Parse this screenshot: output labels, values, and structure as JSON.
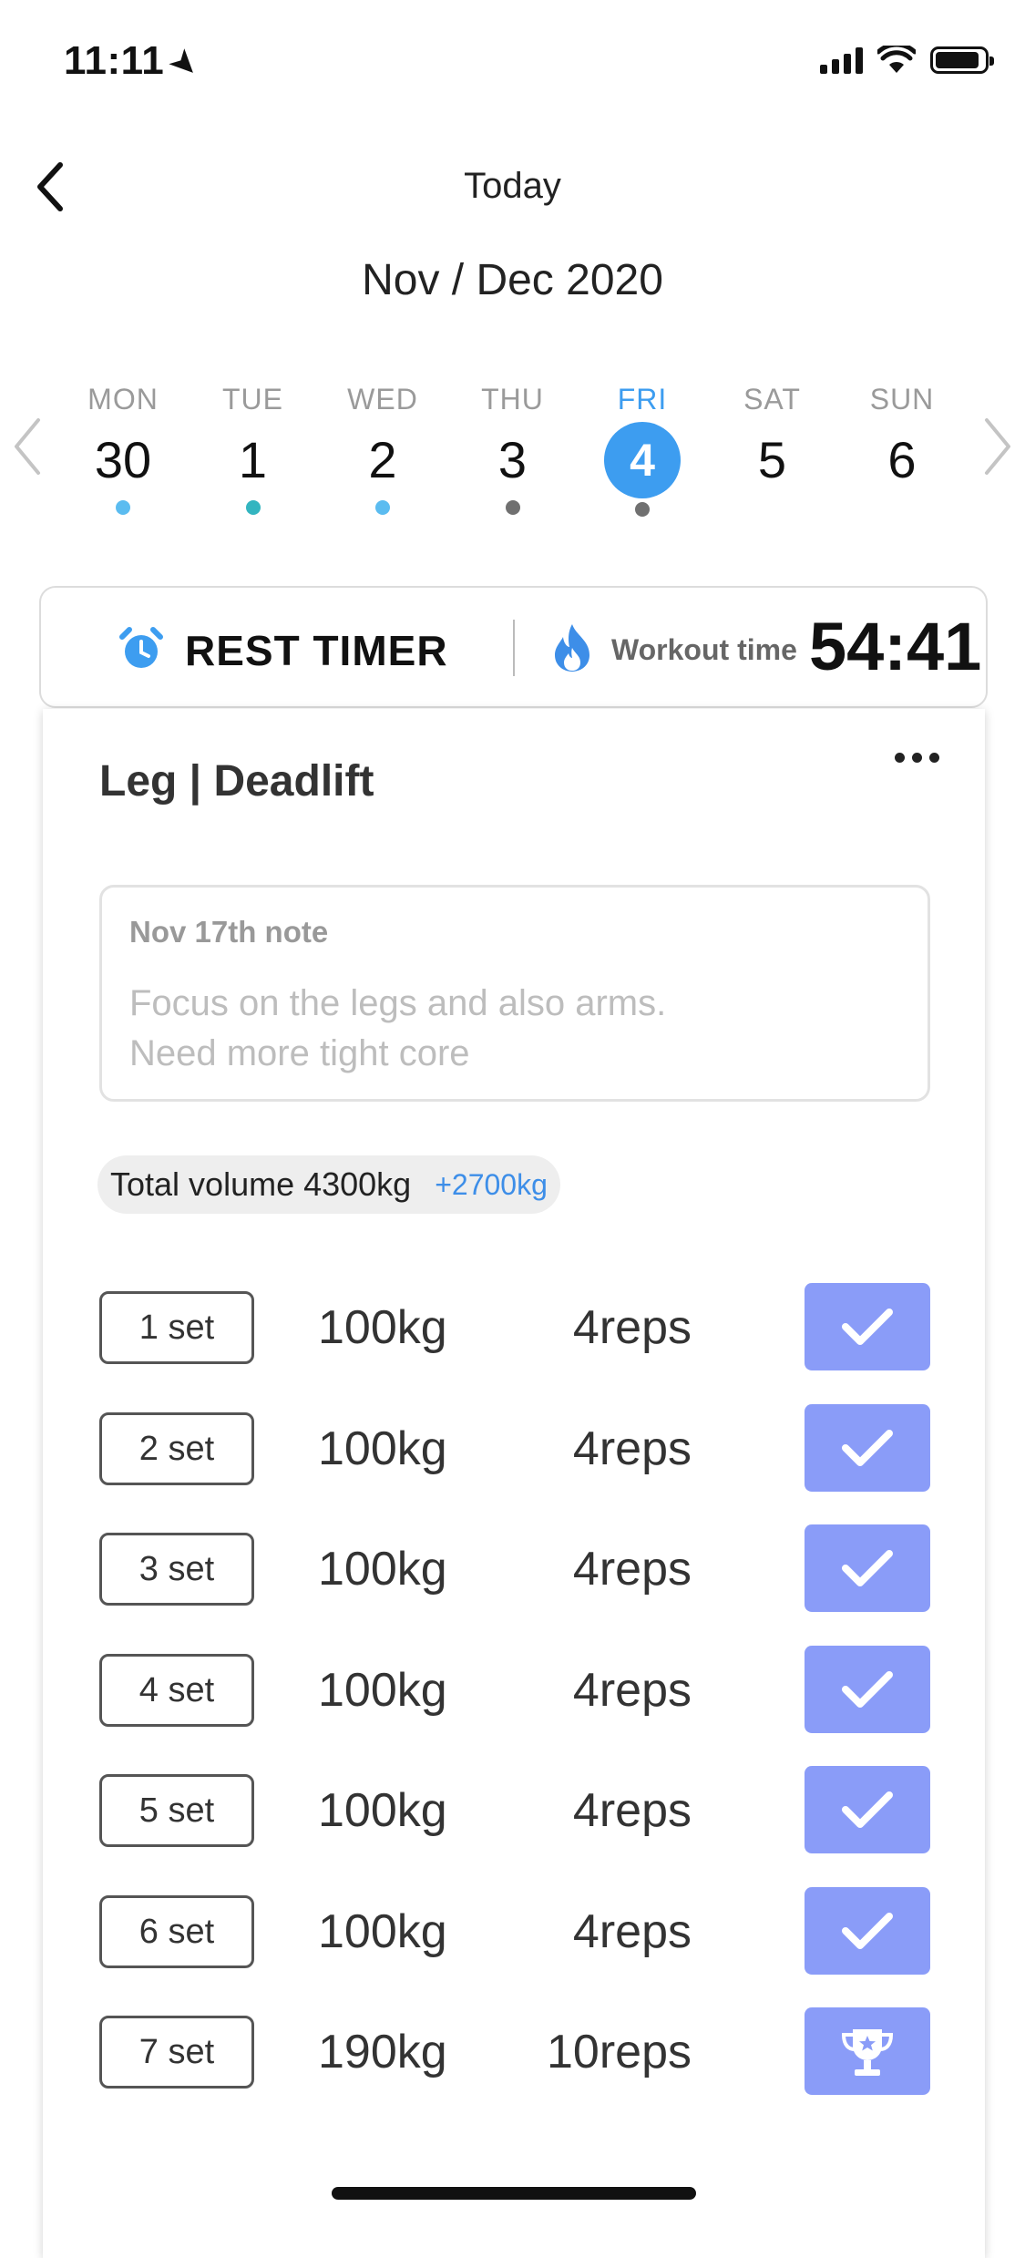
{
  "status_bar": {
    "time": "11:11"
  },
  "header": {
    "title": "Today",
    "month": "Nov / Dec 2020"
  },
  "week": [
    {
      "name": "MON",
      "num": "30",
      "dot": "#5bbcf0"
    },
    {
      "name": "TUE",
      "num": "1",
      "dot": "#33b5c0"
    },
    {
      "name": "WED",
      "num": "2",
      "dot": "#5bbcf0"
    },
    {
      "name": "THU",
      "num": "3",
      "dot": "#707070"
    },
    {
      "name": "FRI",
      "num": "4",
      "dot": "#707070",
      "selected": true
    },
    {
      "name": "SAT",
      "num": "5",
      "dot": ""
    },
    {
      "name": "SUN",
      "num": "6",
      "dot": ""
    }
  ],
  "timer": {
    "rest_label": "REST TIMER",
    "workout_label": "Workout time",
    "workout_value": "54:41"
  },
  "exercise": {
    "title": "Leg | Deadlift",
    "note_date": "Nov 17th  note",
    "note_text": "Focus on the legs and also arms.\nNeed more tight core",
    "volume_label": "Total volume 4300kg",
    "volume_delta": "+2700kg",
    "sets": [
      {
        "label": "1 set",
        "weight": "100kg",
        "reps": "4reps",
        "icon": "check-icon"
      },
      {
        "label": "2 set",
        "weight": "100kg",
        "reps": "4reps",
        "icon": "check-icon"
      },
      {
        "label": "3 set",
        "weight": "100kg",
        "reps": "4reps",
        "icon": "check-icon"
      },
      {
        "label": "4 set",
        "weight": "100kg",
        "reps": "4reps",
        "icon": "check-icon"
      },
      {
        "label": "5 set",
        "weight": "100kg",
        "reps": "4reps",
        "icon": "check-icon"
      },
      {
        "label": "6 set",
        "weight": "100kg",
        "reps": "4reps",
        "icon": "check-icon"
      },
      {
        "label": "7 set",
        "weight": "190kg",
        "reps": "10reps",
        "icon": "trophy-icon"
      }
    ]
  },
  "colors": {
    "accent": "#3d9df0",
    "check_button": "#8a9cf8",
    "delta": "#3d8ee8"
  }
}
